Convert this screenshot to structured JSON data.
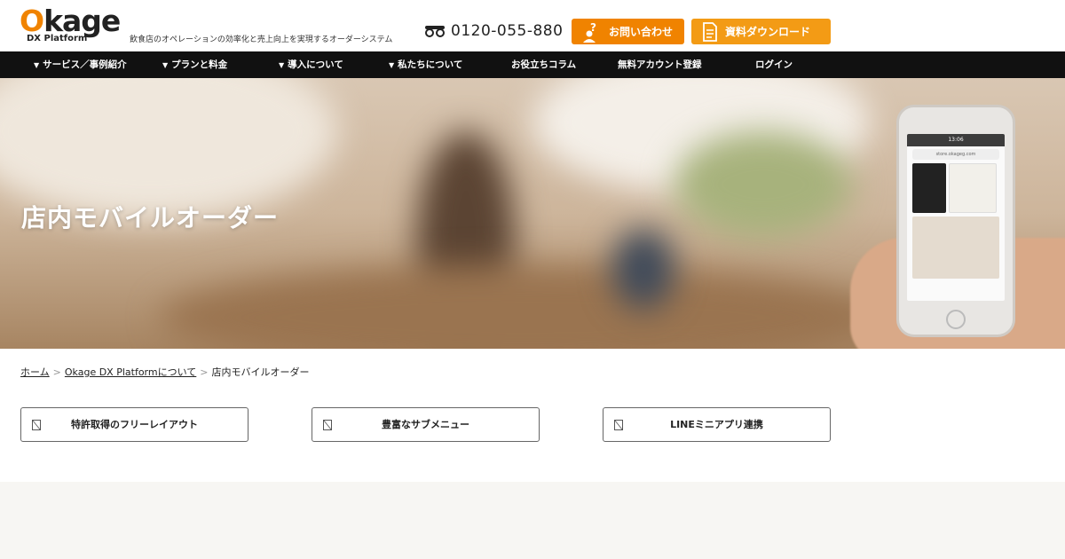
{
  "header": {
    "logo_main_o": "O",
    "logo_main_rest": "kage",
    "logo_sub": "DX Platform",
    "tagline": "飲食店のオペレーションの効率化と売上向上を実現するオーダーシステム",
    "phone_number": "0120-055-880",
    "contact_label": "お問い合わせ",
    "download_label": "資料ダウンロード",
    "accent_color": "#f08300"
  },
  "nav": {
    "items": [
      {
        "label": "サービス／事例紹介",
        "has_caret": true
      },
      {
        "label": "プランと料金",
        "has_caret": true
      },
      {
        "label": "導入について",
        "has_caret": true
      },
      {
        "label": "私たちについて",
        "has_caret": true
      },
      {
        "label": "お役立ちコラム",
        "has_caret": false
      },
      {
        "label": "無料アカウント登録",
        "has_caret": false
      },
      {
        "label": "ログイン",
        "has_caret": false
      }
    ]
  },
  "hero": {
    "title": "店内モバイルオーダー",
    "phone_url": "store.okageg.com",
    "phone_time": "13:06"
  },
  "breadcrumb": {
    "home": "ホーム",
    "parent": "Okage DX Platformについて",
    "current": "店内モバイルオーダー",
    "separator": ">"
  },
  "features": [
    {
      "label": "特許取得のフリーレイアウト"
    },
    {
      "label": "豊富なサブメニュー"
    },
    {
      "label": "LINEミニアプリ連携"
    }
  ]
}
